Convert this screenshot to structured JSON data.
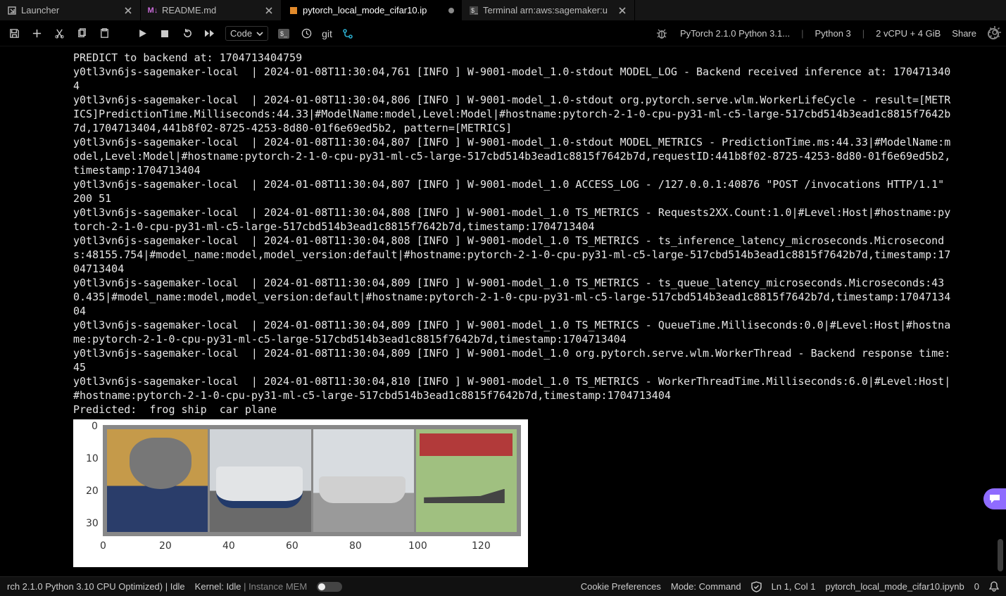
{
  "tabs": [
    {
      "icon": "launcher-icon",
      "label": "Launcher",
      "closable": true,
      "active": false,
      "dirty": false
    },
    {
      "icon": "markdown-icon",
      "label": "README.md",
      "closable": true,
      "active": false,
      "dirty": false
    },
    {
      "icon": "notebook-icon",
      "label": "pytorch_local_mode_cifar10.ip",
      "closable": false,
      "active": true,
      "dirty": true
    },
    {
      "icon": "terminal-icon",
      "label": "Terminal arn:aws:sagemaker:u",
      "closable": true,
      "active": false,
      "dirty": false
    }
  ],
  "toolbar": {
    "cell_type": "Code",
    "git_label": "git",
    "kernel_image": "PyTorch 2.1.0 Python 3.1...",
    "kernel_lang": "Python 3",
    "instance": "2 vCPU + 4 GiB",
    "share": "Share"
  },
  "log_lines": [
    "PREDICT to backend at: 1704713404759",
    "y0tl3vn6js-sagemaker-local  | 2024-01-08T11:30:04,761 [INFO ] W-9001-model_1.0-stdout MODEL_LOG - Backend received inference at: 1704713404",
    "y0tl3vn6js-sagemaker-local  | 2024-01-08T11:30:04,806 [INFO ] W-9001-model_1.0-stdout org.pytorch.serve.wlm.WorkerLifeCycle - result=[METRICS]PredictionTime.Milliseconds:44.33|#ModelName:model,Level:Model|#hostname:pytorch-2-1-0-cpu-py31-ml-c5-large-517cbd514b3ead1c8815f7642b7d,1704713404,441b8f02-8725-4253-8d80-01f6e69ed5b2, pattern=[METRICS]",
    "y0tl3vn6js-sagemaker-local  | 2024-01-08T11:30:04,807 [INFO ] W-9001-model_1.0-stdout MODEL_METRICS - PredictionTime.ms:44.33|#ModelName:model,Level:Model|#hostname:pytorch-2-1-0-cpu-py31-ml-c5-large-517cbd514b3ead1c8815f7642b7d,requestID:441b8f02-8725-4253-8d80-01f6e69ed5b2,timestamp:1704713404",
    "y0tl3vn6js-sagemaker-local  | 2024-01-08T11:30:04,807 [INFO ] W-9001-model_1.0 ACCESS_LOG - /127.0.0.1:40876 \"POST /invocations HTTP/1.1\" 200 51",
    "y0tl3vn6js-sagemaker-local  | 2024-01-08T11:30:04,808 [INFO ] W-9001-model_1.0 TS_METRICS - Requests2XX.Count:1.0|#Level:Host|#hostname:pytorch-2-1-0-cpu-py31-ml-c5-large-517cbd514b3ead1c8815f7642b7d,timestamp:1704713404",
    "y0tl3vn6js-sagemaker-local  | 2024-01-08T11:30:04,808 [INFO ] W-9001-model_1.0 TS_METRICS - ts_inference_latency_microseconds.Microseconds:48155.754|#model_name:model,model_version:default|#hostname:pytorch-2-1-0-cpu-py31-ml-c5-large-517cbd514b3ead1c8815f7642b7d,timestamp:1704713404",
    "y0tl3vn6js-sagemaker-local  | 2024-01-08T11:30:04,809 [INFO ] W-9001-model_1.0 TS_METRICS - ts_queue_latency_microseconds.Microseconds:430.435|#model_name:model,model_version:default|#hostname:pytorch-2-1-0-cpu-py31-ml-c5-large-517cbd514b3ead1c8815f7642b7d,timestamp:1704713404",
    "y0tl3vn6js-sagemaker-local  | 2024-01-08T11:30:04,809 [INFO ] W-9001-model_1.0 TS_METRICS - QueueTime.Milliseconds:0.0|#Level:Host|#hostname:pytorch-2-1-0-cpu-py31-ml-c5-large-517cbd514b3ead1c8815f7642b7d,timestamp:1704713404",
    "y0tl3vn6js-sagemaker-local  | 2024-01-08T11:30:04,809 [INFO ] W-9001-model_1.0 org.pytorch.serve.wlm.WorkerThread - Backend response time: 45",
    "y0tl3vn6js-sagemaker-local  | 2024-01-08T11:30:04,810 [INFO ] W-9001-model_1.0 TS_METRICS - WorkerThreadTime.Milliseconds:6.0|#Level:Host|#hostname:pytorch-2-1-0-cpu-py31-ml-c5-large-517cbd514b3ead1c8815f7642b7d,timestamp:1704713404",
    "Predicted:  frog ship  car plane"
  ],
  "plot": {
    "yticks": [
      "0",
      "10",
      "20",
      "30"
    ],
    "xticks": [
      "0",
      "20",
      "40",
      "60",
      "80",
      "100",
      "120"
    ]
  },
  "statusbar": {
    "left1": "rch 2.1.0 Python 3.10 CPU Optimized) | Idle",
    "kernel": "Kernel: Idle",
    "mem_label": "Instance MEM",
    "cookie": "Cookie Preferences",
    "mode": "Mode: Command",
    "lncol": "Ln 1, Col 1",
    "file": "pytorch_local_mode_cifar10.ipynb",
    "bellcount": "0"
  }
}
